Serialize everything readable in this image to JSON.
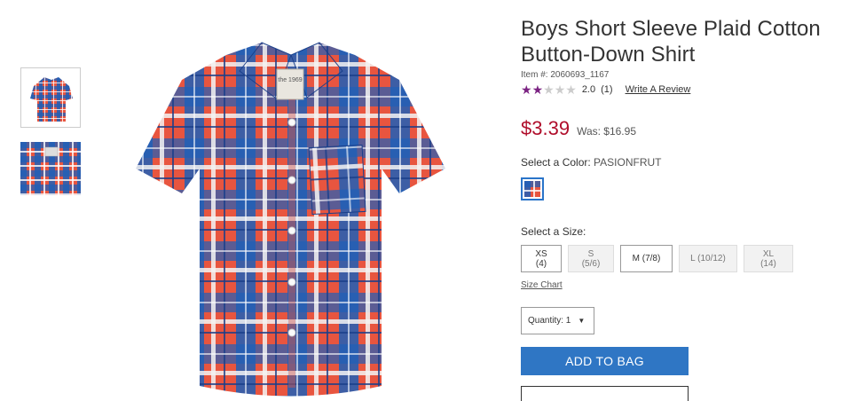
{
  "product": {
    "title": "Boys Short Sleeve Plaid Cotton Button-Down Shirt",
    "item_number": "Item #: 2060693_1167",
    "rating_value": "2.0",
    "rating_count": "(1)",
    "rating_stars": 2,
    "rating_max": 5,
    "write_review": "Write A Review",
    "price": "$3.39",
    "was_price": "Was: $16.95",
    "color_label": "Select a Color:",
    "color_value": "PASIONFRUT",
    "size_label": "Select a Size:",
    "sizes": [
      {
        "label": "XS (4)",
        "available": true
      },
      {
        "label": "S (5/6)",
        "available": false
      },
      {
        "label": "M (7/8)",
        "available": true
      },
      {
        "label": "L (10/12)",
        "available": false
      },
      {
        "label": "XL (14)",
        "available": false
      }
    ],
    "size_chart": "Size Chart",
    "quantity": "Quantity: 1",
    "add_to_bag": "ADD TO BAG",
    "tag_text": "the 1969"
  },
  "colors": {
    "price": "#b00e2b",
    "accent": "#2f76c4",
    "star": "#7b2382",
    "plaid_blue": "#1f5fb8",
    "plaid_red": "#e8553f",
    "plaid_white": "#f3f3f3"
  },
  "icons": {
    "star": "star-icon",
    "caret": "caret-down-icon"
  }
}
